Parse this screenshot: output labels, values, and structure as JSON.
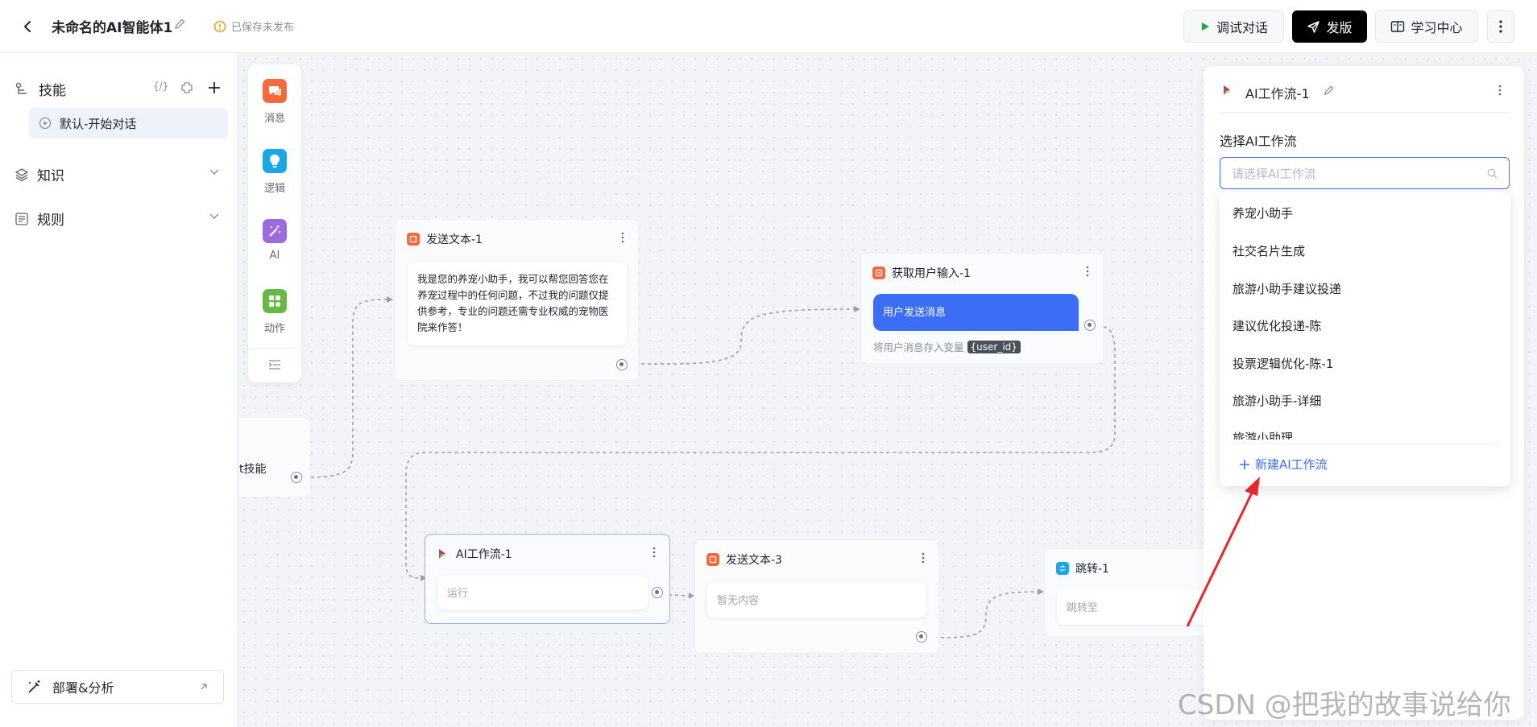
{
  "header": {
    "title": "未命名的AI智能体1",
    "status": "已保存未发布",
    "debug_label": "调试对话",
    "publish_label": "发版",
    "learn_label": "学习中心"
  },
  "sidebar": {
    "skills_label": "技能",
    "default_skill": "默认-开始对话",
    "knowledge_label": "知识",
    "rules_label": "规则",
    "deploy_label": "部署&分析"
  },
  "palette": {
    "items": [
      {
        "label": "消息",
        "color": "#f56a3c"
      },
      {
        "label": "逻辑",
        "color": "#1aa7e8"
      },
      {
        "label": "AI",
        "color": "#9b6cde"
      },
      {
        "label": "动作",
        "color": "#67b946"
      }
    ]
  },
  "nodes": {
    "start_partial": "t技能",
    "send1": {
      "title": "发送文本-1",
      "text": "我是您的养宠小助手，我可以帮您回答您在养宠过程中的任何问题，不过我的问题仅提供参考，专业的问题还需专业权威的宠物医院来作答！"
    },
    "input1": {
      "title": "获取用户输入-1",
      "bubble": "用户发送消息",
      "note": "将用户消息存入变量",
      "var": "{user_id}"
    },
    "ai1": {
      "title": "AI工作流-1",
      "placeholder": "运行"
    },
    "send3": {
      "title": "发送文本-3",
      "placeholder": "暂无内容"
    },
    "jump1": {
      "title": "跳转-1",
      "placeholder": "跳转至"
    }
  },
  "right_panel": {
    "title": "AI工作流-1",
    "field_label": "选择AI工作流",
    "placeholder": "请选择AI工作流",
    "options": [
      "养宠小助手",
      "社交名片生成",
      "旅游小助手建议投递",
      "建议优化投递-陈",
      "投票逻辑优化-陈-1",
      "旅游小助手-详细",
      "旅游小助理"
    ],
    "new_label": "新建AI工作流"
  },
  "colors": {
    "accent": "#3b6ef5",
    "bubble": "#3b6ef5",
    "arrow": "#e8262b"
  },
  "watermark": "CSDN @把我的故事说给你"
}
